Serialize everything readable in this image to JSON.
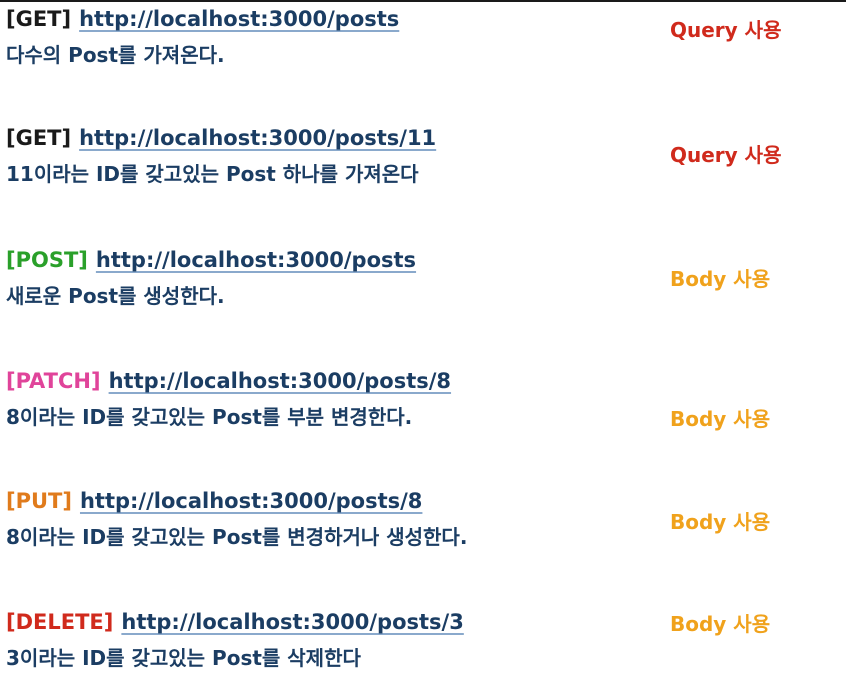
{
  "entries": [
    {
      "method": "[GET]",
      "url": "http://localhost:3000/posts",
      "description": "다수의 Post를 가져온다.",
      "usage": "Query 사용",
      "method_color": "#1a1a1a",
      "usage_color": "#d02a1c"
    },
    {
      "method": "[GET]",
      "url": "http://localhost:3000/posts/11",
      "description": "11이라는 ID를 갖고있는 Post 하나를 가져온다",
      "usage": "Query 사용",
      "method_color": "#1a1a1a",
      "usage_color": "#d02a1c"
    },
    {
      "method": "[POST]",
      "url": "http://localhost:3000/posts",
      "description": "새로운 Post를 생성한다.",
      "usage": "Body 사용",
      "method_color": "#2aa02a",
      "usage_color": "#f0a21c"
    },
    {
      "method": "[PATCH]",
      "url": "http://localhost:3000/posts/8",
      "description": "8이라는 ID를 갖고있는 Post를 부분 변경한다.",
      "usage": "Body 사용",
      "method_color": "#e0449a",
      "usage_color": "#f0a21c"
    },
    {
      "method": "[PUT]",
      "url": "http://localhost:3000/posts/8",
      "description": "8이라는 ID를 갖고있는 Post를 변경하거나 생성한다.",
      "usage": "Body 사용",
      "method_color": "#e07b1c",
      "usage_color": "#f0a21c"
    },
    {
      "method": "[DELETE]",
      "url": "http://localhost:3000/posts/3",
      "description": "3이라는 ID를 갖고있는 Post를 삭제한다",
      "usage": "Body 사용",
      "method_color": "#d02a1c",
      "usage_color": "#f0a21c"
    }
  ]
}
